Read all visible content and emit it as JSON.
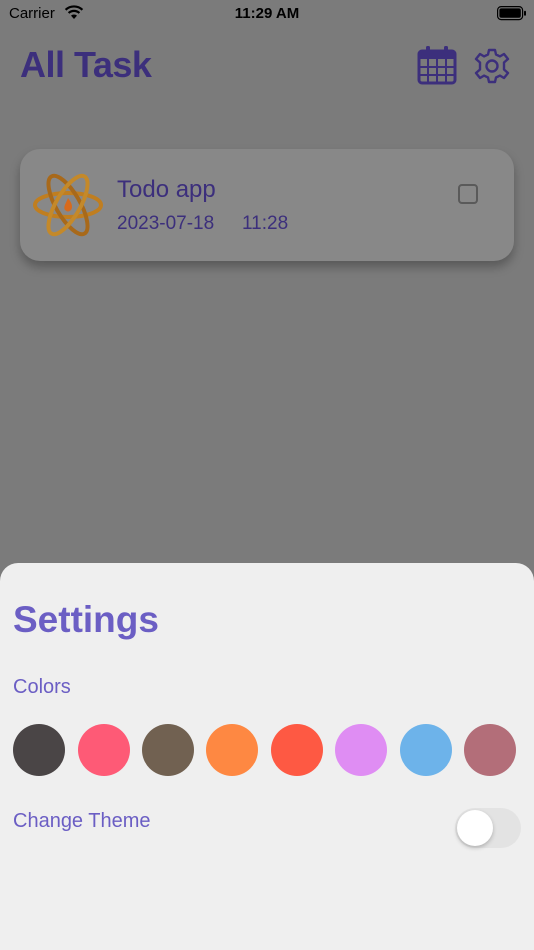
{
  "status_bar": {
    "carrier": "Carrier",
    "time": "11:29 AM",
    "wifi_icon": "wifi-icon",
    "battery_icon": "battery-icon"
  },
  "header": {
    "title": "All Task",
    "calendar_icon": "calendar-icon",
    "settings_icon": "gear-icon"
  },
  "tasks": [
    {
      "title": "Todo app",
      "date": "2023-07-18",
      "time": "11:28",
      "icon": "atom-logo",
      "completed": false
    }
  ],
  "settings_sheet": {
    "title": "Settings",
    "colors_label": "Colors",
    "colors": [
      "#4a4546",
      "#fe5a76",
      "#716151",
      "#fe8842",
      "#fe5943",
      "#df8df3",
      "#6db3ea",
      "#b36e79"
    ],
    "theme_label": "Change Theme",
    "theme_enabled": false
  },
  "theme": {
    "accent": "#6b5ec4",
    "header_accent": "#3c2f7c"
  }
}
